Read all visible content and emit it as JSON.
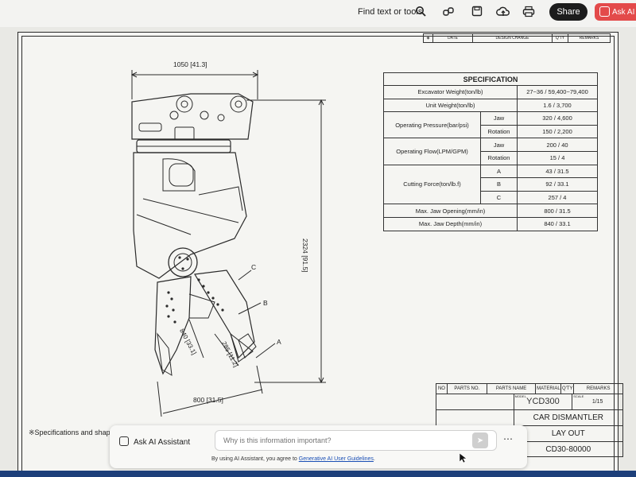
{
  "toolbar": {
    "find_text": "Find text or tools",
    "share_label": "Share",
    "askai_label": "Ask AI",
    "icons": [
      "search-icon",
      "link-icon",
      "save-icon",
      "cloud-upload-icon",
      "print-icon"
    ]
  },
  "revision_header": {
    "date": "DATE",
    "design_change": "DESIGN CHANGE",
    "qty": "Q'TY",
    "remarks": "REMARKS"
  },
  "dimensions": {
    "width_top": "1050 [41.3]",
    "height_total": "2324 [91.5]",
    "jaw_opening": "800 [31.5]",
    "jaw_depth": "840 [33.1]",
    "jaw_other": "285 [11.2]",
    "label_a": "A",
    "label_b": "B",
    "label_c": "C"
  },
  "spec": {
    "title": "SPECIFICATION",
    "rows": {
      "excavator_label": "Excavator Weight(ton/lb)",
      "excavator_value": "27~36 / 59,400~79,400",
      "unit_label": "Unit Weight(ton/lb)",
      "unit_value": "1.6 / 3,700",
      "pressure_label": "Operating Pressure(bar/psi)",
      "pressure_jaw": "Jaw",
      "pressure_jaw_value": "320 / 4,600",
      "pressure_rot": "Rotation",
      "pressure_rot_value": "150 / 2,200",
      "flow_label": "Operating Flow(LPM/GPM)",
      "flow_jaw": "Jaw",
      "flow_jaw_value": "200 / 40",
      "flow_rot": "Rotation",
      "flow_rot_value": "15 / 4",
      "cutting_label": "Cutting Force(ton/lb.f)",
      "cut_a": "A",
      "cut_a_value": "43 / 31.5",
      "cut_b": "B",
      "cut_b_value": "92 / 33.1",
      "cut_c": "C",
      "cut_c_value": "257 / 4",
      "opening_label": "Max. Jaw Opening(mm/in)",
      "opening_value": "800 / 31.5",
      "depth_label": "Max. Jaw Depth(mm/in)",
      "depth_value": "840 / 33.1"
    }
  },
  "title_block": {
    "no": "NO",
    "parts_no": "PARTS NO.",
    "parts_name": "PARTS NAME",
    "material": "MATERIAL",
    "qty": "Q'TY",
    "remarks": "REMARKS",
    "model_label": "MODEL",
    "model": "YCD300",
    "scale_label": "SCALE",
    "scale": "1/15",
    "name": "CAR DISMANTLER",
    "drawing": "LAY OUT",
    "drawing_no": "CD30-80000"
  },
  "notes": "※Specifications and shap",
  "ai_assistant": {
    "title": "Ask AI Assistant",
    "placeholder": "Why is this information important?",
    "footer_prefix": "By using AI Assistant, you agree to",
    "footer_link": "Generative AI User Guidelines",
    "footer_suffix": "."
  }
}
